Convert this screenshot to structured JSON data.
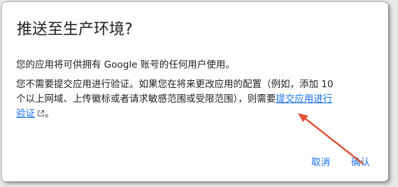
{
  "dialog": {
    "title": "推送至生产环境?",
    "paragraph1": "您的应用将可供拥有 Google 账号的任何用户使用。",
    "paragraph2": {
      "line1": "您不需要提交应用进行验证。如果您在将来更改应用的配置（例如，添加 10",
      "line2_text": "个以上网域、上传徽标或者请求敏感范围或受限范围），则需要",
      "link_part1": "提交应用进行",
      "link_part2": "验证",
      "link_icon": "external-link-icon",
      "line3_tail": "。"
    },
    "buttons": {
      "cancel": "取消",
      "confirm": "确认"
    }
  },
  "annotation": {
    "arrow_color": "#e0533a"
  },
  "colors": {
    "link": "#1a73e8",
    "text": "#202124",
    "backdrop": "#e9e9e9"
  }
}
